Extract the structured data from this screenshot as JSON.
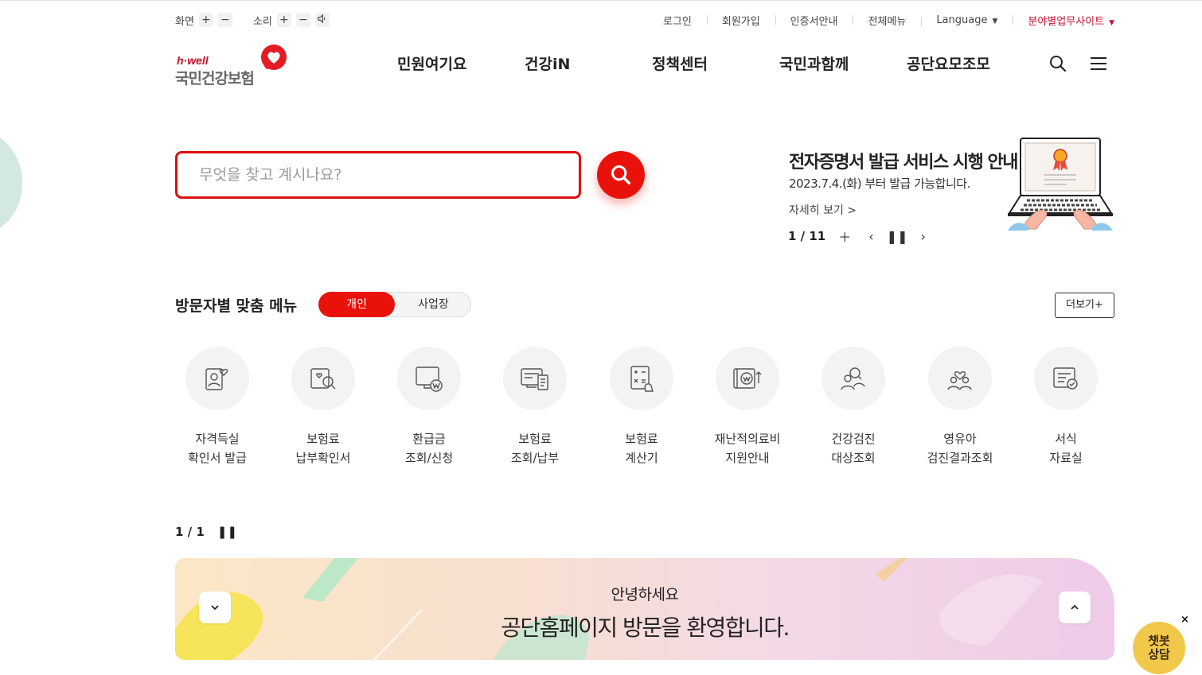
{
  "util": {
    "screen_label": "화면",
    "sound_label": "소리",
    "plus": "+",
    "minus": "−",
    "links": [
      "로그인",
      "회원가입",
      "인증서안내",
      "전체메뉴"
    ],
    "language": "Language",
    "field_sites": "분야별업무사이트"
  },
  "logo": {
    "tag": "h·well",
    "name": "국민건강보험"
  },
  "gnb": [
    "민원여기요",
    "건강iN",
    "정책센터",
    "국민과함께",
    "공단요모조모"
  ],
  "search": {
    "placeholder": "무엇을 찾고 계시나요?"
  },
  "banner": {
    "title": "전자증명서 발급 서비스 시행 안내",
    "subtitle": "2023.7.4.(화) 부터 발급 가능합니다.",
    "more": "자세히 보기 >",
    "pager": "1 / 11"
  },
  "visitor": {
    "title": "방문자별 맞춤 메뉴",
    "tab_personal": "개인",
    "tab_business": "사업장",
    "more": "더보기+"
  },
  "quick_menu": [
    {
      "line1": "자격득실",
      "line2": "확인서 발급",
      "icon": "certificate-person-icon"
    },
    {
      "line1": "보험료",
      "line2": "납부확인서",
      "icon": "receipt-search-icon"
    },
    {
      "line1": "환급금",
      "line2": "조회/신청",
      "icon": "refund-monitor-icon"
    },
    {
      "line1": "보험료",
      "line2": "조회/납부",
      "icon": "payment-document-icon"
    },
    {
      "line1": "보험료",
      "line2": "계산기",
      "icon": "calculator-icon"
    },
    {
      "line1": "재난적의료비",
      "line2": "지원안내",
      "icon": "medical-cost-icon"
    },
    {
      "line1": "건강검진",
      "line2": "대상조회",
      "icon": "checkup-people-icon"
    },
    {
      "line1": "영유아",
      "line2": "검진결과조회",
      "icon": "infant-checkup-icon"
    },
    {
      "line1": "서식",
      "line2": "자료실",
      "icon": "form-library-icon"
    }
  ],
  "quick_pager": "1 / 1",
  "welcome": {
    "hello": "안녕하세요",
    "message": "공단홈페이지 방문을 환영합니다."
  },
  "chatbot": {
    "line1": "챗봇",
    "line2": "상담",
    "close": "×"
  },
  "colors": {
    "brand_red": "#e8120b",
    "chatbot_yellow": "#f2c84b"
  }
}
